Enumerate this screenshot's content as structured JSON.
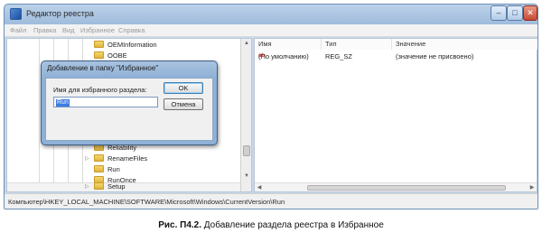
{
  "window": {
    "title": "Редактор реестра",
    "controls": {
      "minimize": "–",
      "maximize": "□",
      "close": "✕"
    }
  },
  "menu": [
    "Файл",
    "Правка",
    "Вид",
    "Избранное",
    "Справка"
  ],
  "tree": {
    "items_top": [
      "OEMInformation",
      "OOBE"
    ],
    "items_bottom": [
      "Reliability",
      "RenameFiles",
      "Run",
      "RunOnce",
      "Setup"
    ]
  },
  "values": {
    "headers": {
      "name": "Имя",
      "type": "Тип",
      "data": "Значение"
    },
    "rows": [
      {
        "name": "(По умолчанию)",
        "type": "REG_SZ",
        "data": "(значение не присвоено)"
      }
    ],
    "icon_text": "ab"
  },
  "status": {
    "path": "Компьютер\\HKEY_LOCAL_MACHINE\\SOFTWARE\\Microsoft\\Windows\\CurrentVersion\\Run"
  },
  "dialog": {
    "title": "Добавление в папку \"Избранное\"",
    "label": "Имя для избранного раздела:",
    "input_value": "Run",
    "ok": "OK",
    "cancel": "Отмена"
  },
  "caption": {
    "label": "Рис. П4.2.",
    "text": " Добавление раздела реестра в Избранное"
  }
}
